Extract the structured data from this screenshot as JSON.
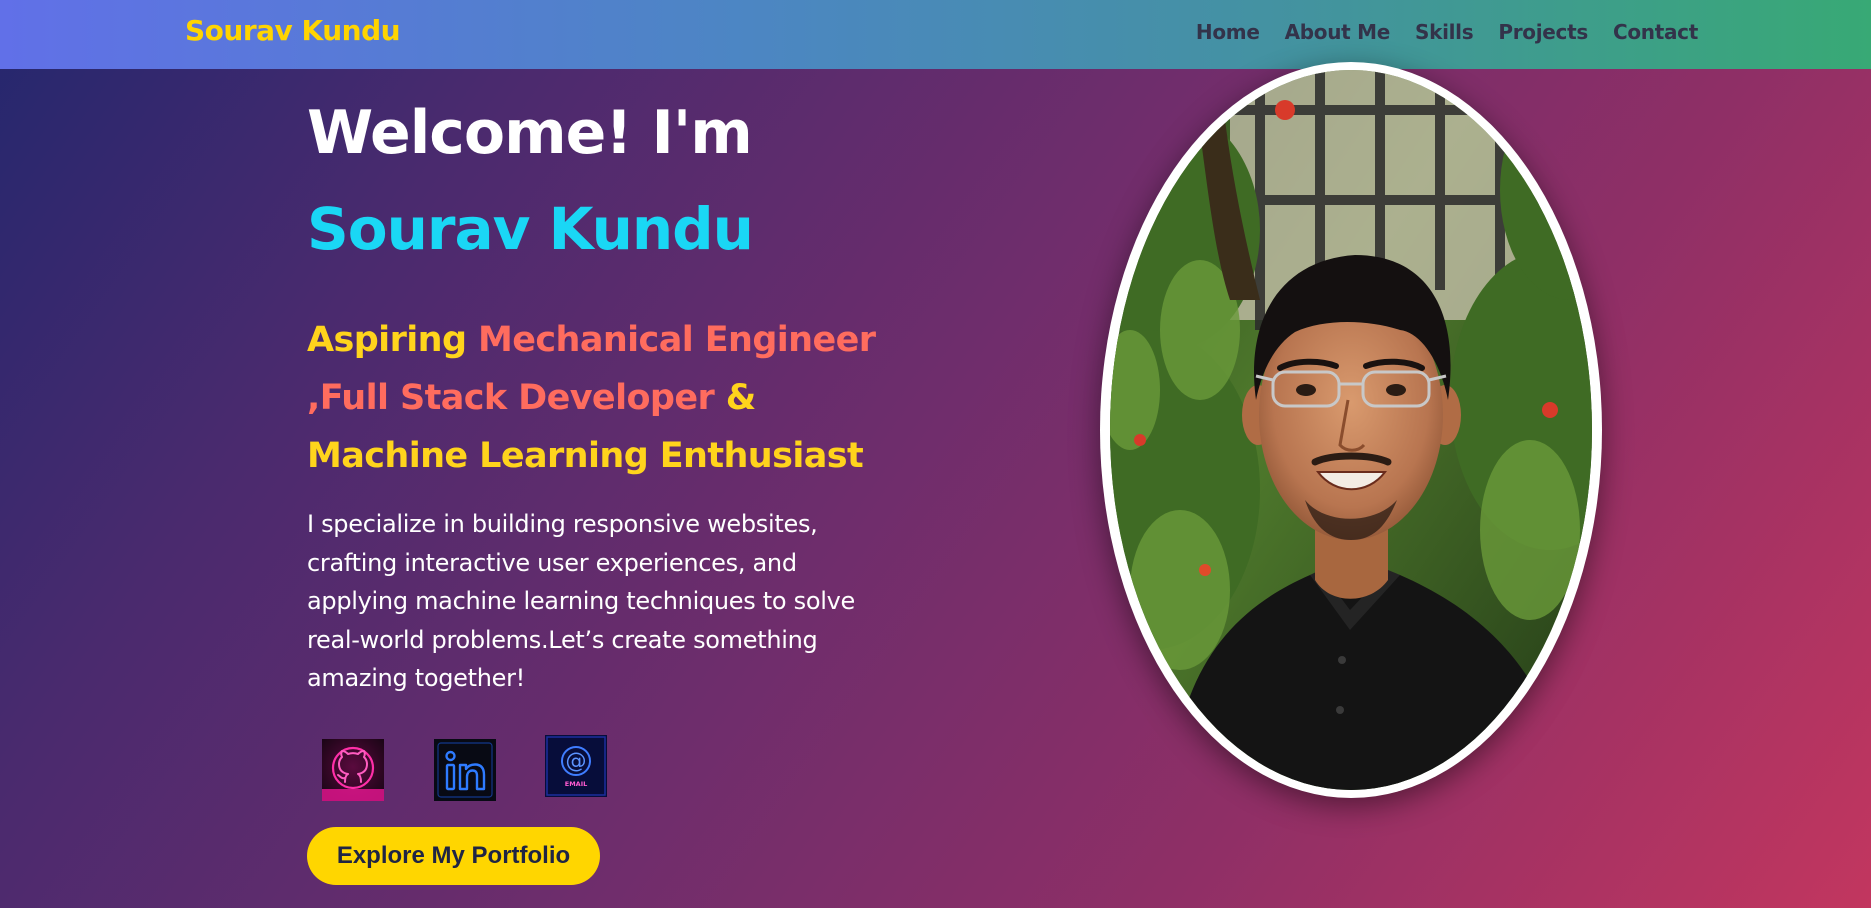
{
  "header": {
    "brand": "Sourav Kundu",
    "nav": [
      "Home",
      "About Me",
      "Skills",
      "Projects",
      "Contact"
    ]
  },
  "hero": {
    "greeting": "Welcome! I'm",
    "name": "Sourav Kundu",
    "tagline": {
      "part1": "Aspiring ",
      "part2": "Mechanical Engineer",
      "part3": ",Full Stack Developer",
      "part4": " &",
      "part5": "Machine Learning Enthusiast"
    },
    "bio": "I specialize in building responsive websites, crafting interactive user experiences, and applying machine learning techniques to solve real-world problems.Let’s create something amazing together!",
    "cta": "Explore My Portfolio"
  },
  "social": [
    {
      "icon": "github-icon",
      "color": "#ff2fa8"
    },
    {
      "icon": "linkedin-icon",
      "color": "#1e63ff"
    },
    {
      "icon": "email-icon",
      "color": "#2f6bff",
      "label": "EMAIL"
    }
  ],
  "colors": {
    "brand": "#ffd400",
    "name": "#1ad7f5",
    "tagline_yellow": "#ffd41c",
    "tagline_coral": "#ff6c5e",
    "cta_bg": "#ffd600",
    "nav_text": "#33334a"
  }
}
